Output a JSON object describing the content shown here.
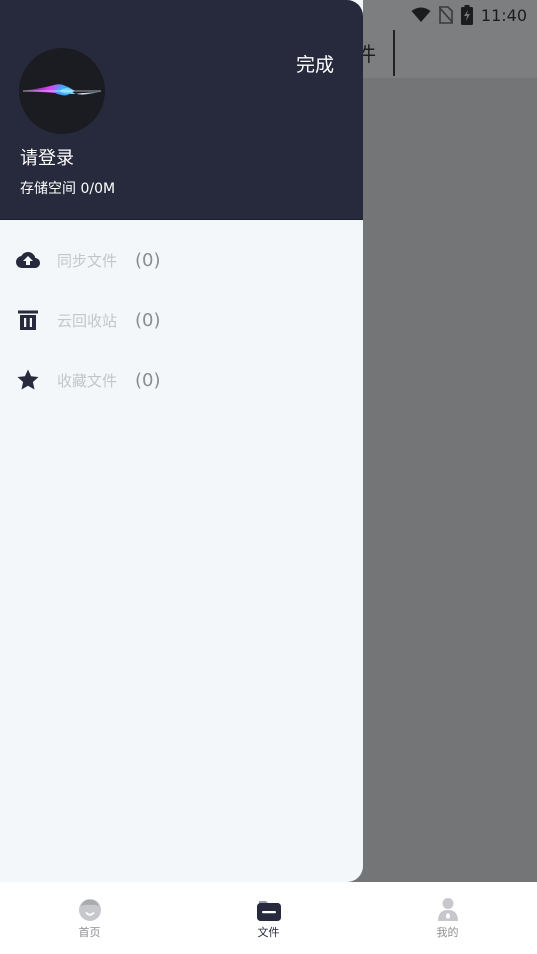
{
  "status_bar": {
    "time": "11:40",
    "icons": [
      "wifi-icon",
      "no-sim-icon",
      "battery-charging-icon"
    ]
  },
  "background": {
    "title_fragment": "件"
  },
  "drawer": {
    "done_label": "完成",
    "login_label": "请登录",
    "storage_label": "存储空间 0/0M",
    "menu": [
      {
        "icon": "cloud-upload-icon",
        "label": "同步文件",
        "count": "(0)"
      },
      {
        "icon": "trash-icon",
        "label": "云回收站",
        "count": "(0)"
      },
      {
        "icon": "star-icon",
        "label": "收藏文件",
        "count": "(0)"
      }
    ]
  },
  "bottom_nav": [
    {
      "icon": "home-face-icon",
      "label": "首页",
      "active": false
    },
    {
      "icon": "folder-icon",
      "label": "文件",
      "active": true
    },
    {
      "icon": "person-lock-icon",
      "label": "我的",
      "active": false
    }
  ],
  "colors": {
    "drawer_header": "#272a3c",
    "drawer_body": "#f3f7fa",
    "overlay": "#747577",
    "accent": "#272a3c"
  }
}
